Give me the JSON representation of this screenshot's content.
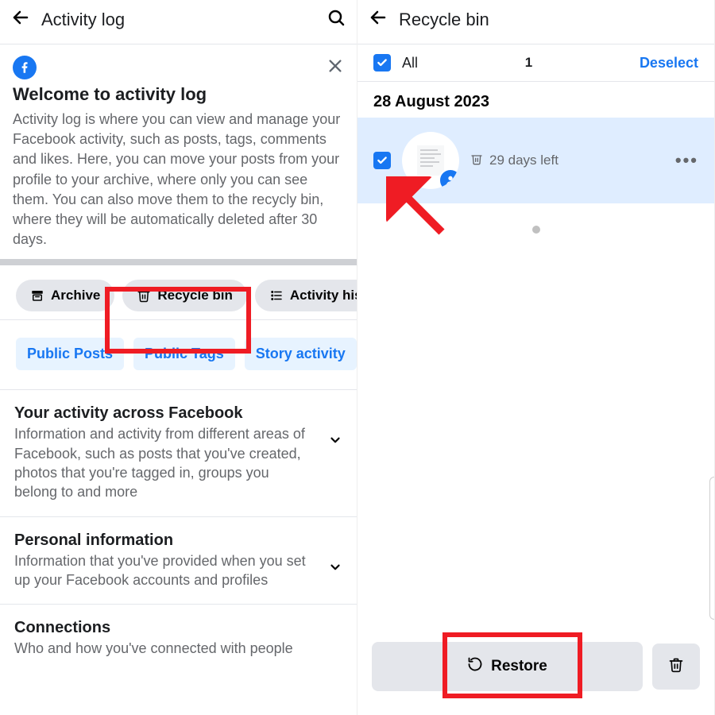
{
  "left": {
    "title": "Activity log",
    "hero_title": "Welcome to activity log",
    "hero_body": "Activity log is where you can view and manage your Facebook activity, such as posts, tags, comments and likes. Here, you can move your posts from your profile to your archive, where only you can see them. You can also move them to the recycly bin, where they will be automatically deleted after 30 days.",
    "chip_archive": "Archive",
    "chip_recycle": "Recycle bin",
    "chip_history": "Activity his",
    "bchip_public_posts": "Public Posts",
    "bchip_public_tags": "Public Tags",
    "bchip_story": "Story activity",
    "section_activity_title": "Your activity across Facebook",
    "section_activity_body": "Information and activity from different areas of Facebook, such as posts that you've created, photos that you're tagged in, groups you belong to and more",
    "section_personal_title": "Personal information",
    "section_personal_body": "Information that you've provided when you set up your Facebook accounts and profiles",
    "section_connections_title": "Connections",
    "section_connections_body": "Who and how you've connected with people"
  },
  "right": {
    "title": "Recycle bin",
    "all_label": "All",
    "count": "1",
    "deselect": "Deselect",
    "date_header": "28 August 2023",
    "days_left": "29 days left",
    "restore": "Restore"
  }
}
